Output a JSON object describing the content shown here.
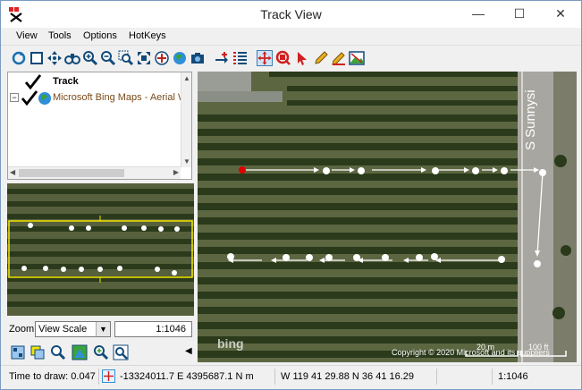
{
  "window": {
    "title": "Track View"
  },
  "window_controls": {
    "minimize": "—",
    "maximize": "☐",
    "close": "✕"
  },
  "menu": [
    "View",
    "Tools",
    "Options",
    "HotKeys"
  ],
  "toolbar_icons": [
    "refresh-icon",
    "stop-icon",
    "pan-all-icon",
    "binoculars-icon",
    "zoom-in-icon",
    "zoom-out-icon",
    "zoom-rect-icon",
    "zoom-extents-icon",
    "layers-icon",
    "globe-icon",
    "camera-icon",
    "add-point-icon",
    "list-icon",
    "move-tool-icon",
    "stop-tool-icon",
    "select-tool-icon",
    "pencil-icon",
    "edit-icon",
    "map-image-icon"
  ],
  "tree": {
    "items": [
      {
        "label": "Track",
        "checked": true
      },
      {
        "label": "Microsoft Bing Maps - Aerial W",
        "checked": true,
        "color": "#7a4a1a"
      }
    ]
  },
  "zoom": {
    "label": "Zoom",
    "scale_mode": "View Scale",
    "scale_value": "1:1046"
  },
  "mini_tools": [
    "mini-tool-1-icon",
    "mini-tool-2-icon",
    "magnifier-icon",
    "map-frame-icon",
    "zoom-plus-icon",
    "zoom-target-icon"
  ],
  "map": {
    "road_label": "S Sunnysi",
    "attribution": "Copyright © 2020 Microsoft and its suppliers",
    "scale_labels": [
      "20 m",
      "100 ft"
    ],
    "watermark": "bing"
  },
  "status": {
    "time_to_draw": "Time to draw: 0.047",
    "projected": "-13324011.7 E  4395687.1 N m",
    "geographic": "W 119 41 29.88  N 36 41 16.29",
    "blank": "",
    "scale": "1:1046"
  },
  "colors": {
    "track_line": "#ffffff",
    "start_point": "#e00000",
    "overview_frame": "#f2e600"
  }
}
